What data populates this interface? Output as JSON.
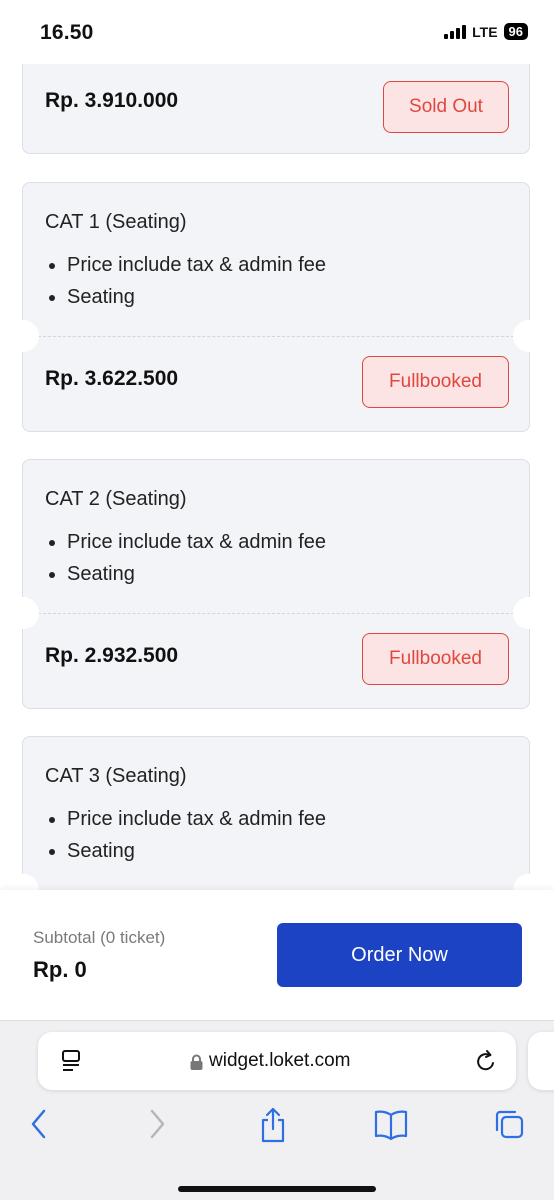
{
  "status_bar": {
    "time": "16.50",
    "network": "LTE",
    "battery": "96"
  },
  "tickets": [
    {
      "title": "",
      "features": [],
      "price": "Rp. 3.910.000",
      "status": "Sold Out"
    },
    {
      "title": "CAT 1 (Seating)",
      "features": [
        "Price include tax & admin fee",
        "Seating"
      ],
      "price": "Rp. 3.622.500",
      "status": "Fullbooked"
    },
    {
      "title": "CAT 2 (Seating)",
      "features": [
        "Price include tax & admin fee",
        "Seating"
      ],
      "price": "Rp. 2.932.500",
      "status": "Fullbooked"
    },
    {
      "title": "CAT 3 (Seating)",
      "features": [
        "Price include tax & admin fee",
        "Seating"
      ],
      "price": "",
      "status": ""
    }
  ],
  "footer": {
    "subtotal_label": "Subtotal (0 ticket)",
    "subtotal_value": "Rp. 0",
    "order_button": "Order Now"
  },
  "browser": {
    "url": "widget.loket.com",
    "icons": [
      "reader-icon",
      "lock-icon",
      "reload-icon",
      "back-icon",
      "forward-icon",
      "share-icon",
      "bookmarks-icon",
      "tabs-icon"
    ]
  },
  "colors": {
    "accent": "#1c43c4",
    "status_red": "#e0473f",
    "status_bg": "#fde4e4",
    "card_bg": "#f3f4f8"
  }
}
